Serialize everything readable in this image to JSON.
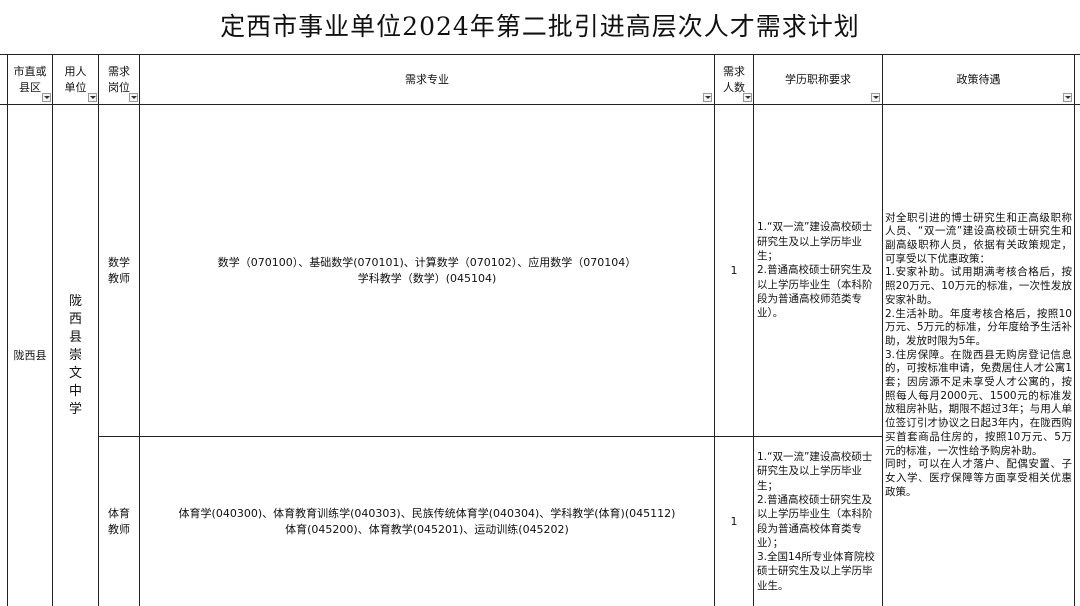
{
  "title": "定西市事业单位2024年第二批引进高层次人才需求计划",
  "headers": {
    "county": "市直或县区",
    "employer": "用人单位",
    "post": "需求岗位",
    "major": "需求专业",
    "count": "需求人数",
    "education": "学历职称要求",
    "policy": "政策待遇"
  },
  "county": "陇西县",
  "employer": "陇西县崇文中学",
  "rows": [
    {
      "post": "数学教师",
      "major_line1": "数学（070100）、基础数学(070101)、计算数学（070102）、应用数学（070104）",
      "major_line2": "学科教学（数学）(045104)",
      "count": "1",
      "education": "1.“双一流”建设高校硕士研究生及以上学历毕业生；\n2.普通高校硕士研究生及以上学历毕业生（本科阶段为普通高校师范类专业）。"
    },
    {
      "post": "体育教师",
      "major_line1": "体育学(040300)、体育教育训练学(040303)、民族传统体育学(040304)、学科教学(体育)(045112)",
      "major_line2": "体育(045200)、体育教学(045201)、运动训练(045202)",
      "count": "1",
      "education": "1.“双一流”建设高校硕士研究生及以上学历毕业生；\n2.普通高校硕士研究生及以上学历毕业生（本科阶段为普通高校体育类专业）；\n3.全国14所专业体育院校硕士研究生及以上学历毕业生。"
    }
  ],
  "policy": "对全职引进的博士研究生和正高级职称人员、“双一流”建设高校硕士研究生和副高级职称人员，依据有关政策规定，可享受以下优惠政策：\n1.安家补助。试用期满考核合格后，按照20万元、10万元的标准，一次性发放安家补助。\n2.生活补助。年度考核合格后，按照10万元、5万元的标准，分年度给予生活补助，发放时限为5年。\n3.住房保障。在陇西县无购房登记信息的，可按标准申请，免费居住人才公寓1套；因房源不足未享受人才公寓的，按照每人每月2000元、1500元的标准发放租房补贴，期限不超过3年；与用人单位签订引才协议之日起3年内，在陇西购买首套商品住房的，按照10万元、5万元的标准，一次性给予购房补助。\n同时，可以在人才落户、配偶安置、子女入学、医疗保障等方面享受相关优惠政策。"
}
